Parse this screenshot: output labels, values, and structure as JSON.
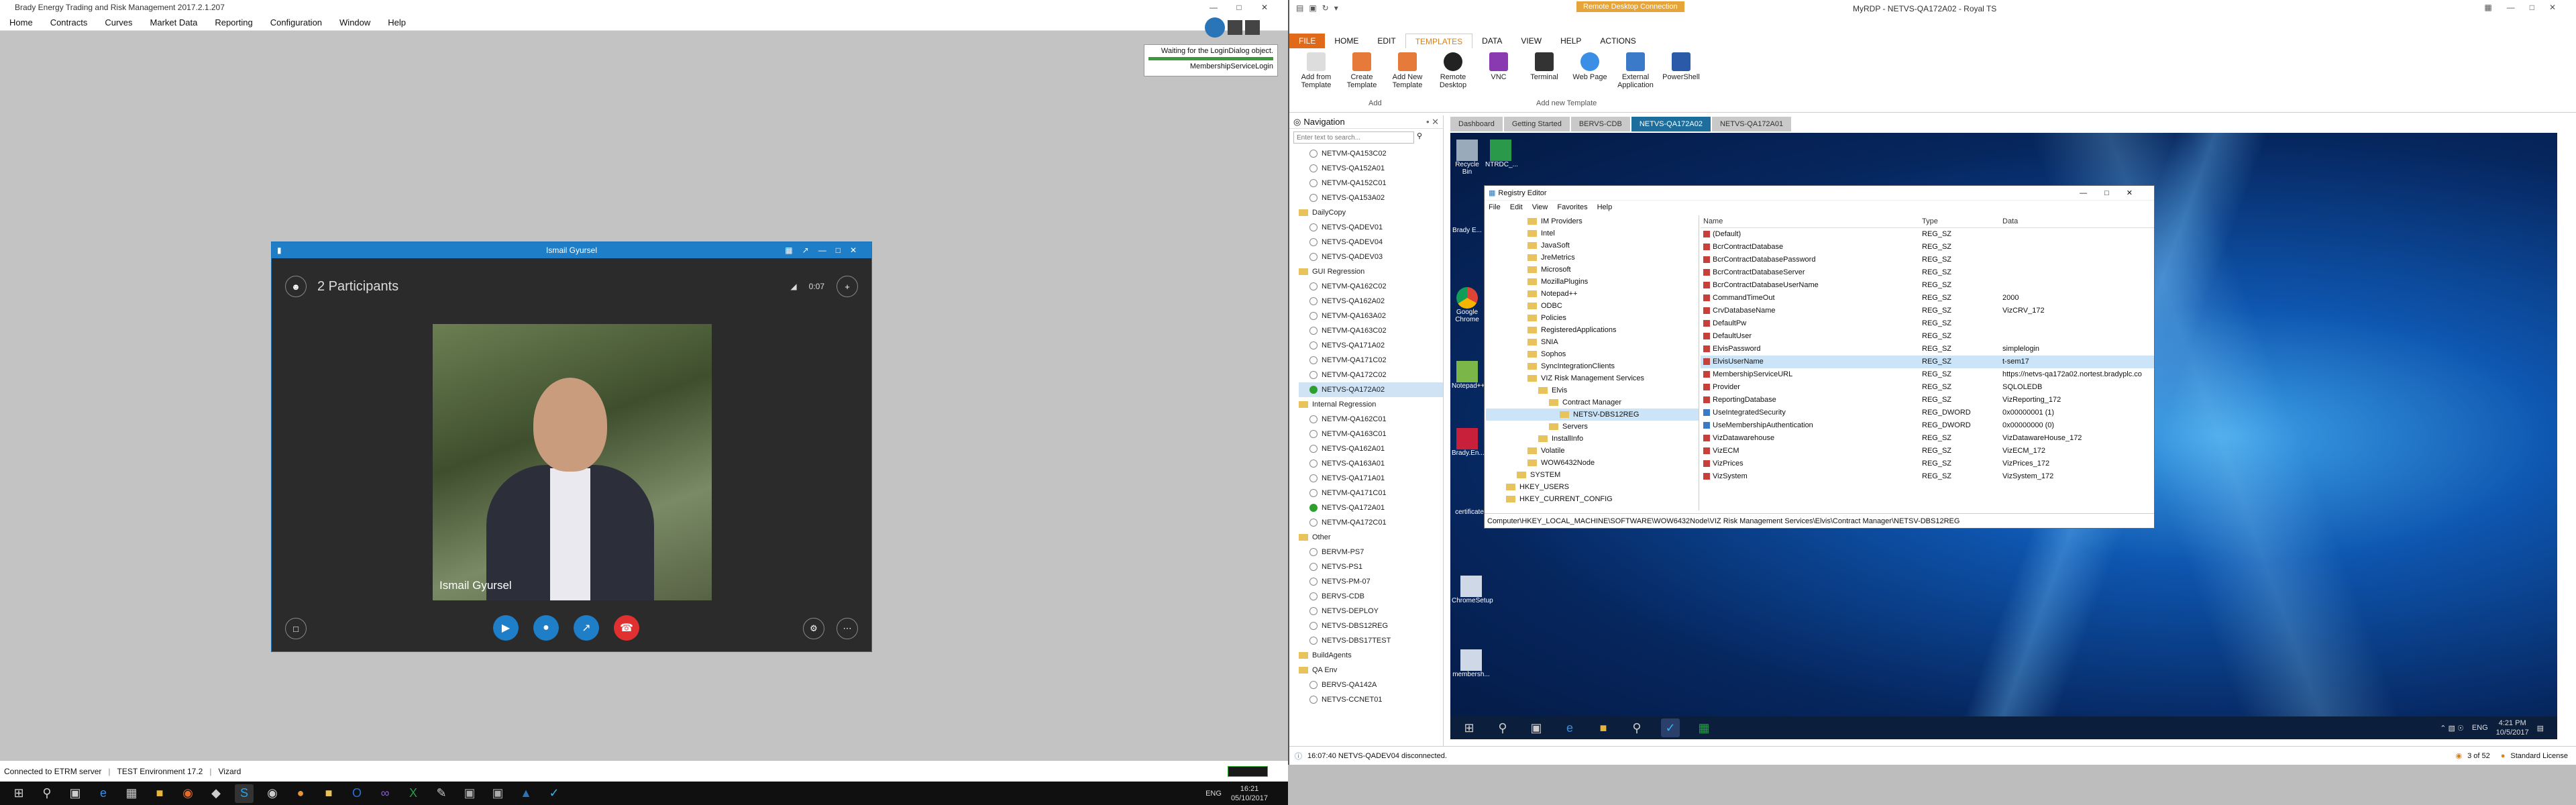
{
  "etrm": {
    "title": "Brady Energy Trading and Risk Management 2017.2.1.207",
    "menu": [
      "Home",
      "Contracts",
      "Curves",
      "Market Data",
      "Reporting",
      "Configuration",
      "Window",
      "Help"
    ],
    "wait_text": "Waiting for the LoginDialog object.",
    "wait_sub": "MembershipServiceLogin",
    "status_server": "Connected to ETRM server",
    "status_env": "TEST Environment 17.2",
    "status_wizard": "Vizard",
    "clock_time": "16:21",
    "clock_date": "05/10/2017",
    "lang": "ENG"
  },
  "skype": {
    "window_title": "Ismail Gyursel",
    "participants": "2 Participants",
    "speaker_name": "Ismail Gyursel",
    "signal_label": "0:07",
    "accent": "#1e7ec8",
    "hangup_color": "#e03030"
  },
  "royal": {
    "title": "MyRDP - NETVS-QA172A02 - Royal TS",
    "context_title": "Remote Desktop Connection",
    "tabs": [
      "FILE",
      "HOME",
      "EDIT",
      "TEMPLATES",
      "DATA",
      "VIEW",
      "HELP",
      "ACTIONS"
    ],
    "ribbon": [
      {
        "label": "Add from Template"
      },
      {
        "label": "Create Template"
      },
      {
        "label": "Add New Template"
      },
      {
        "label": "Remote Desktop"
      },
      {
        "label": "VNC"
      },
      {
        "label": "Terminal"
      },
      {
        "label": "Web Page"
      },
      {
        "label": "External Application"
      },
      {
        "label": "PowerShell"
      }
    ],
    "group_add": "Add",
    "group_template": "Add new Template",
    "nav_title": "Navigation",
    "nav_filter_placeholder": "Enter text to search...",
    "nav_items": [
      {
        "label": "NETVM-QA153C02",
        "type": "srv"
      },
      {
        "label": "NETVS-QA152A01",
        "type": "srv"
      },
      {
        "label": "NETVM-QA152C01",
        "type": "srv"
      },
      {
        "label": "NETVS-QA153A02",
        "type": "srv"
      },
      {
        "label": "DailyCopy",
        "type": "fld"
      },
      {
        "label": "NETVS-QADEV01",
        "type": "srv"
      },
      {
        "label": "NETVS-QADEV04",
        "type": "srv"
      },
      {
        "label": "NETVS-QADEV03",
        "type": "srv"
      },
      {
        "label": "GUI Regression",
        "type": "fld"
      },
      {
        "label": "NETVM-QA162C02",
        "type": "srv"
      },
      {
        "label": "NETVS-QA162A02",
        "type": "srv"
      },
      {
        "label": "NETVM-QA163A02",
        "type": "srv"
      },
      {
        "label": "NETVM-QA163C02",
        "type": "srv"
      },
      {
        "label": "NETVS-QA171A02",
        "type": "srv"
      },
      {
        "label": "NETVM-QA171C02",
        "type": "srv"
      },
      {
        "label": "NETVM-QA172C02",
        "type": "srv"
      },
      {
        "label": "NETVS-QA172A02",
        "type": "on"
      },
      {
        "label": "Internal Regression",
        "type": "fld"
      },
      {
        "label": "NETVM-QA162C01",
        "type": "srv"
      },
      {
        "label": "NETVM-QA163C01",
        "type": "srv"
      },
      {
        "label": "NETVS-QA162A01",
        "type": "srv"
      },
      {
        "label": "NETVS-QA163A01",
        "type": "srv"
      },
      {
        "label": "NETVS-QA171A01",
        "type": "srv"
      },
      {
        "label": "NETVM-QA171C01",
        "type": "srv"
      },
      {
        "label": "NETVS-QA172A01",
        "type": "on"
      },
      {
        "label": "NETVM-QA172C01",
        "type": "srv"
      },
      {
        "label": "Other",
        "type": "fld"
      },
      {
        "label": "BERVM-PS7",
        "type": "srv"
      },
      {
        "label": "NETVS-PS1",
        "type": "srv"
      },
      {
        "label": "NETVS-PM-07",
        "type": "srv"
      },
      {
        "label": "BERVS-CDB",
        "type": "srv"
      },
      {
        "label": "NETVS-DEPLOY",
        "type": "srv"
      },
      {
        "label": "NETVS-DBS12REG",
        "type": "srv"
      },
      {
        "label": "NETVS-DBS17TEST",
        "type": "srv"
      },
      {
        "label": "BuildAgents",
        "type": "fld"
      },
      {
        "label": "QA Env",
        "type": "fld"
      },
      {
        "label": "BERVS-QA142A",
        "type": "srv"
      },
      {
        "label": "NETVS-CCNET01",
        "type": "srv"
      }
    ],
    "doc_tabs": [
      {
        "label": "Dashboard",
        "active": false
      },
      {
        "label": "Getting Started",
        "active": false
      },
      {
        "label": "BERVS-CDB",
        "active": false
      },
      {
        "label": "NETVS-QA172A02",
        "active": true
      },
      {
        "label": "NETVS-QA172A01",
        "active": false
      }
    ],
    "status_msg": "16:07:40 NETVS-QADEV04 disconnected.",
    "status_count": "3 of 52",
    "status_license": "Standard License"
  },
  "desktop": {
    "icons": [
      "Recycle Bin",
      "NTRDC_...",
      "Brady E...",
      "Google Chrome",
      "Notepad++",
      "Brady.En...",
      "certificates",
      "ChromeSetup",
      "membersh..."
    ],
    "clock_time": "4:21 PM",
    "clock_date": "10/5/2017",
    "lang": "ENG"
  },
  "regedit": {
    "title": "Registry Editor",
    "menu": [
      "File",
      "Edit",
      "View",
      "Favorites",
      "Help"
    ],
    "tree": [
      {
        "label": "IM Providers",
        "depth": 1
      },
      {
        "label": "Intel",
        "depth": 1
      },
      {
        "label": "JavaSoft",
        "depth": 1
      },
      {
        "label": "JreMetrics",
        "depth": 1
      },
      {
        "label": "Microsoft",
        "depth": 1
      },
      {
        "label": "MozillaPlugins",
        "depth": 1
      },
      {
        "label": "Notepad++",
        "depth": 1
      },
      {
        "label": "ODBC",
        "depth": 1
      },
      {
        "label": "Policies",
        "depth": 1
      },
      {
        "label": "RegisteredApplications",
        "depth": 1
      },
      {
        "label": "SNIA",
        "depth": 1
      },
      {
        "label": "Sophos",
        "depth": 1
      },
      {
        "label": "SyncIntegrationClients",
        "depth": 1
      },
      {
        "label": "VIZ Risk Management Services",
        "depth": 1
      },
      {
        "label": "Elvis",
        "depth": 2
      },
      {
        "label": "Contract Manager",
        "depth": 3
      },
      {
        "label": "NETSV-DBS12REG",
        "depth": 4
      },
      {
        "label": "Servers",
        "depth": 3
      },
      {
        "label": "InstallInfo",
        "depth": 2
      },
      {
        "label": "Volatile",
        "depth": 1
      },
      {
        "label": "WOW6432Node",
        "depth": 1
      },
      {
        "label": "SYSTEM",
        "depth": 0
      },
      {
        "label": "HKEY_USERS",
        "depth": -1
      },
      {
        "label": "HKEY_CURRENT_CONFIG",
        "depth": -1
      }
    ],
    "cols": [
      "Name",
      "Type",
      "Data"
    ],
    "rows": [
      {
        "name": "(Default)",
        "type": "REG_SZ",
        "data": ""
      },
      {
        "name": "BcrContractDatabase",
        "type": "REG_SZ",
        "data": ""
      },
      {
        "name": "BcrContractDatabasePassword",
        "type": "REG_SZ",
        "data": ""
      },
      {
        "name": "BcrContractDatabaseServer",
        "type": "REG_SZ",
        "data": ""
      },
      {
        "name": "BcrContractDatabaseUserName",
        "type": "REG_SZ",
        "data": ""
      },
      {
        "name": "CommandTimeOut",
        "type": "REG_SZ",
        "data": "2000"
      },
      {
        "name": "CrvDatabaseName",
        "type": "REG_SZ",
        "data": "VizCRV_172"
      },
      {
        "name": "DefaultPw",
        "type": "REG_SZ",
        "data": ""
      },
      {
        "name": "DefaultUser",
        "type": "REG_SZ",
        "data": ""
      },
      {
        "name": "ElvisPassword",
        "type": "REG_SZ",
        "data": "simplelogin"
      },
      {
        "name": "ElvisUserName",
        "type": "REG_SZ",
        "data": "t-sem17"
      },
      {
        "name": "MembershipServiceURL",
        "type": "REG_SZ",
        "data": "https://netvs-qa172a02.nortest.bradyplc.co"
      },
      {
        "name": "Provider",
        "type": "REG_SZ",
        "data": "SQLOLEDB"
      },
      {
        "name": "ReportingDatabase",
        "type": "REG_SZ",
        "data": "VizReporting_172"
      },
      {
        "name": "UseIntegratedSecurity",
        "type": "REG_DWORD",
        "data": "0x00000001 (1)"
      },
      {
        "name": "UseMembershipAuthentication",
        "type": "REG_DWORD",
        "data": "0x00000000 (0)"
      },
      {
        "name": "VizDatawarehouse",
        "type": "REG_SZ",
        "data": "VizDatawareHouse_172"
      },
      {
        "name": "VizECM",
        "type": "REG_SZ",
        "data": "VizECM_172"
      },
      {
        "name": "VizPrices",
        "type": "REG_SZ",
        "data": "VizPrices_172"
      },
      {
        "name": "VizSystem",
        "type": "REG_SZ",
        "data": "VizSystem_172"
      }
    ],
    "selected_row": "ElvisUserName",
    "path": "Computer\\HKEY_LOCAL_MACHINE\\SOFTWARE\\WOW6432Node\\VIZ Risk Management Services\\Elvis\\Contract Manager\\NETSV-DBS12REG"
  }
}
